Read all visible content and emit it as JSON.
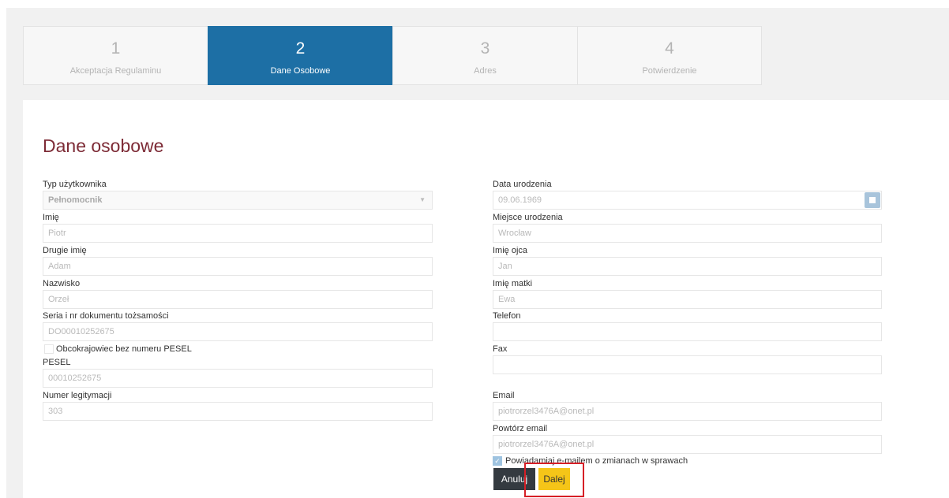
{
  "steps": [
    {
      "num": "1",
      "label": "Akceptacja Regulaminu"
    },
    {
      "num": "2",
      "label": "Dane Osobowe"
    },
    {
      "num": "3",
      "label": "Adres"
    },
    {
      "num": "4",
      "label": "Potwierdzenie"
    }
  ],
  "form": {
    "title": "Dane osobowe",
    "left": {
      "user_type_label": "Typ użytkownika",
      "user_type_value": "Pełnomocnik",
      "first_name_label": "Imię",
      "first_name_value": "Piotr",
      "second_name_label": "Drugie imię",
      "second_name_value": "Adam",
      "last_name_label": "Nazwisko",
      "last_name_value": "Orzeł",
      "id_doc_label": "Seria i nr dokumentu tożsamości",
      "id_doc_value": "DO00010252675",
      "foreigner_label": "Obcokrajowiec bez numeru PESEL",
      "pesel_label": "PESEL",
      "pesel_value": "00010252675",
      "card_label": "Numer legitymacji",
      "card_value": "303"
    },
    "right": {
      "birth_date_label": "Data urodzenia",
      "birth_date_value": "09.06.1969",
      "birth_place_label": "Miejsce urodzenia",
      "birth_place_value": "Wrocław",
      "father_label": "Imię ojca",
      "father_value": "Jan",
      "mother_label": "Imię matki",
      "mother_value": "Ewa",
      "phone_label": "Telefon",
      "phone_value": "",
      "fax_label": "Fax",
      "fax_value": "",
      "email_label": "Email",
      "email_value": "piotrorzel3476A@onet.pl",
      "email_repeat_label": "Powtórz email",
      "email_repeat_value": "piotrorzel3476A@onet.pl",
      "notify_label": "Powiadamiaj e-mailem o zmianach w sprawach"
    },
    "buttons": {
      "cancel": "Anuluj",
      "next": "Dalej"
    }
  },
  "colors": {
    "active_step": "#1d6fa5",
    "title": "#7d2b36",
    "next_button": "#f5c518",
    "highlight": "#d61f26"
  }
}
